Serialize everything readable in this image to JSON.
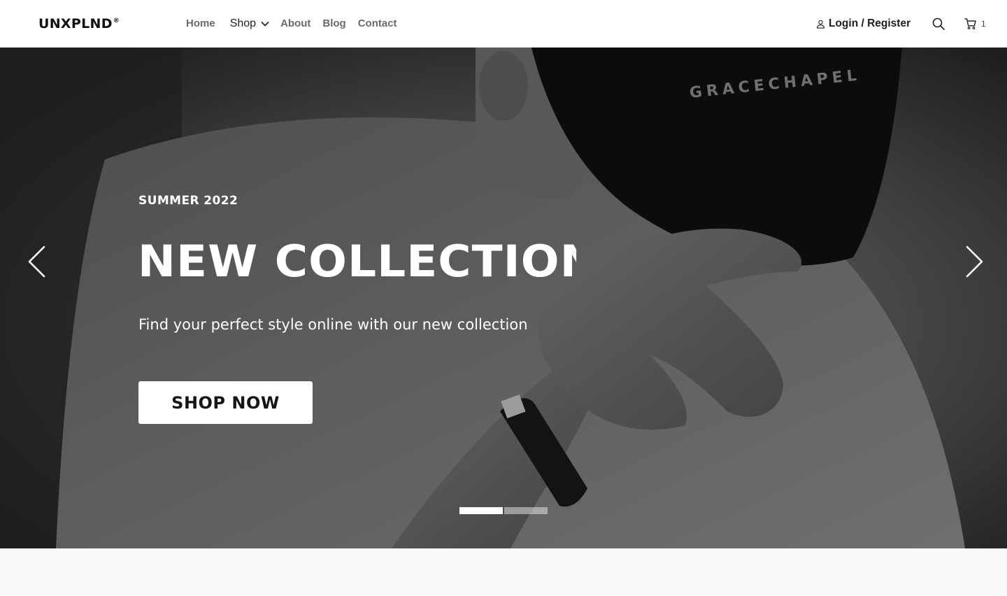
{
  "brand": {
    "name": "UNXPLND",
    "mark": "®"
  },
  "nav": {
    "items": [
      {
        "id": "home",
        "label": "Home"
      },
      {
        "id": "shop",
        "label": "Shop"
      },
      {
        "id": "about",
        "label": "About"
      },
      {
        "id": "blog",
        "label": "Blog"
      },
      {
        "id": "contact",
        "label": "Contact"
      }
    ]
  },
  "header": {
    "login_label": "Login / Register",
    "cart_count": "1",
    "icons": {
      "user": "user-icon",
      "search": "search-icon",
      "cart": "cart-icon",
      "shop_dropdown": "chevron-down-icon"
    }
  },
  "hero": {
    "eyebrow": "SUMMER 2022",
    "headline": "NEW COLLECTION",
    "subcopy": "Find your perfect style online with our new collection",
    "cta_label": "SHOP NOW",
    "slides": {
      "total": 2,
      "active": 1
    },
    "colors": {
      "overlay": "#000000",
      "text": "#ffffff",
      "button_bg": "#ffffff",
      "button_text": "#151515"
    }
  }
}
